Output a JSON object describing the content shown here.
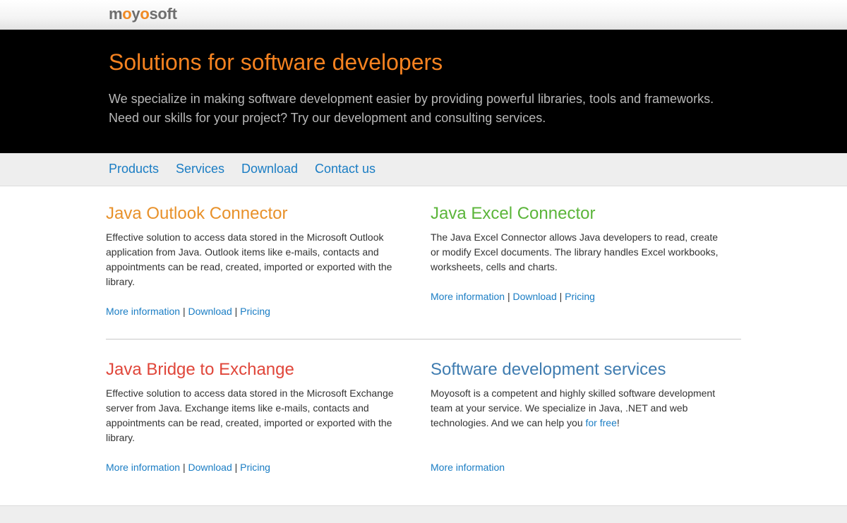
{
  "header": {
    "logo": {
      "part1": "m",
      "part2": "o",
      "part3": "y",
      "part4": "o",
      "part5": "soft"
    }
  },
  "hero": {
    "title": "Solutions for software developers",
    "line1": "We specialize in making software development easier by providing powerful libraries, tools and frameworks.",
    "line2": "Need our skills for your project? Try our development and consulting services."
  },
  "nav": {
    "items": [
      {
        "label": "Products"
      },
      {
        "label": "Services"
      },
      {
        "label": "Download"
      },
      {
        "label": "Contact us"
      }
    ]
  },
  "cards": [
    {
      "title": "Java Outlook Connector",
      "title_color": "#e8912a",
      "text": "Effective solution to access data stored in the Microsoft Outlook application from Java. Outlook items like e-mails, contacts and appointments can be read, created, imported or exported with the library.",
      "link_more": "More information",
      "link_download": "Download",
      "link_pricing": "Pricing",
      "separator": "|"
    },
    {
      "title": "Java Excel Connector",
      "title_color": "#5bb53a",
      "text": "The Java Excel Connector allows Java developers to read, create or modify Excel documents. The library handles Excel workbooks, worksheets, cells and charts.",
      "link_more": "More information",
      "link_download": "Download",
      "link_pricing": "Pricing",
      "separator": "|"
    },
    {
      "title": "Java Bridge to Exchange",
      "title_color": "#e0463a",
      "text": "Effective solution to access data stored in the Microsoft Exchange server from Java. Exchange items like e-mails, contacts and appointments can be read, created, imported or exported with the library.",
      "link_more": "More information",
      "link_download": "Download",
      "link_pricing": "Pricing",
      "separator": "|"
    },
    {
      "title": "Software development services",
      "title_color": "#3f7cb0",
      "text_before": "Moyosoft is a competent and highly skilled software development team at your service. We specialize in Java, .NET and web technologies. And we can help you ",
      "text_link": "for free",
      "text_after": "!",
      "link_more": "More information"
    }
  ],
  "colors": {
    "accent_orange": "#f58220",
    "link_blue": "#1a7dc4"
  }
}
